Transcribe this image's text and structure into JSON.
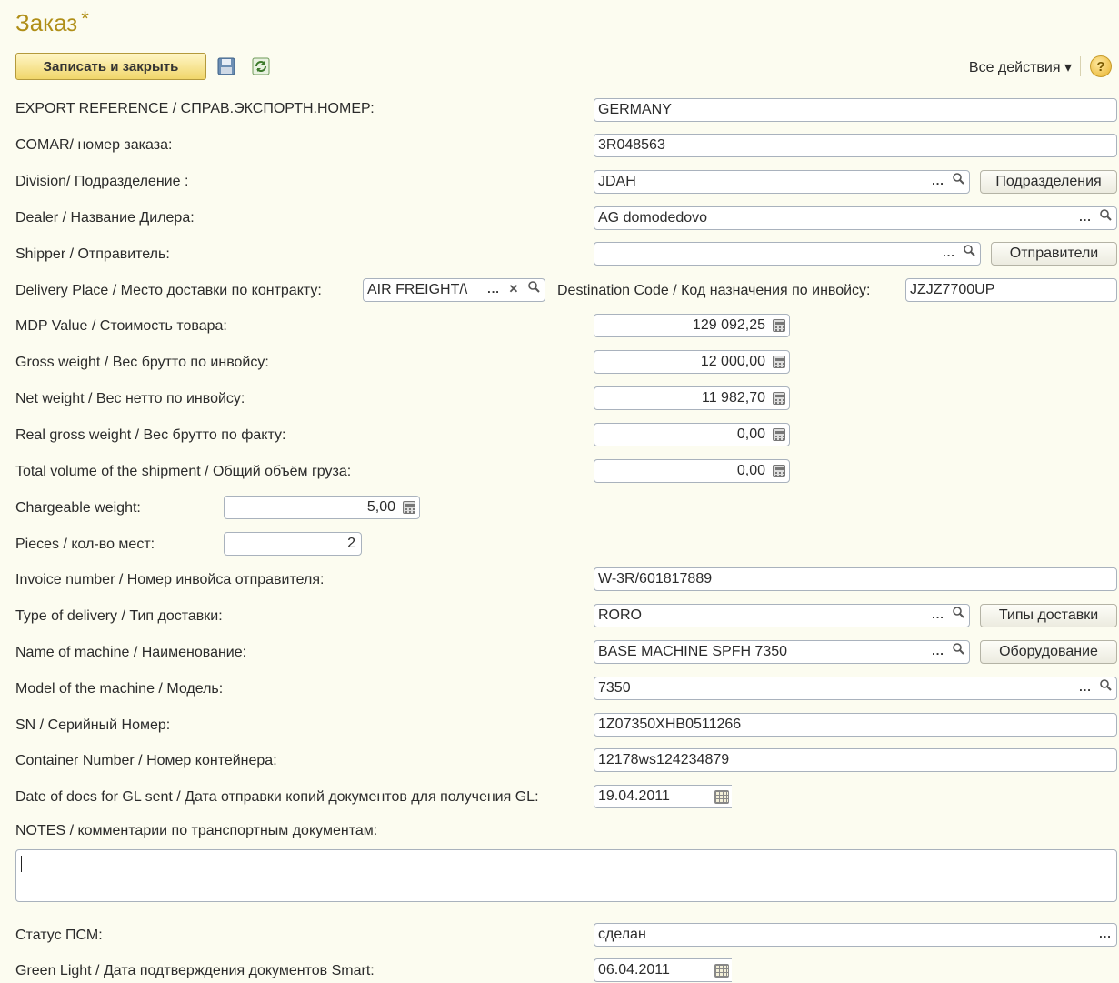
{
  "window": {
    "title": "Заказ",
    "modified_mark": "*"
  },
  "toolbar": {
    "save_close": "Записать и закрыть",
    "all_actions": "Все действия ▾",
    "help": "?",
    "save_icon": "floppy-disk-icon",
    "refresh_icon": "refresh-icon"
  },
  "fields": {
    "export_ref": {
      "label": "EXPORT REFERENCE / СПРАВ.ЭКСПОРТН.НОМЕР:",
      "value": "GERMANY"
    },
    "comar": {
      "label": "COMAR/ номер заказа:",
      "value": "3R048563"
    },
    "division": {
      "label": "Division/ Подразделение :",
      "value": "JDAH",
      "button": "Подразделения"
    },
    "dealer": {
      "label": "Dealer / Название Дилера:",
      "value": "AG domodedovo"
    },
    "shipper": {
      "label": "Shipper / Отправитель:",
      "value": "",
      "button": "Отправители"
    },
    "delivery_place": {
      "label": "Delivery Place / Место доставки по контракту:",
      "value": "AIR FREIGHT/\\"
    },
    "dest_code": {
      "label": "Destination Code / Код назначения по инвойсу:",
      "value": "JZJZ7700UP"
    },
    "mdp_value": {
      "label": "MDP Value / Стоимость товара:",
      "value": "129 092,25"
    },
    "gross_weight": {
      "label": "Gross weight / Вес брутто по инвойсу:",
      "value": "12 000,00"
    },
    "net_weight": {
      "label": "Net weight / Вес нетто по инвойсу:",
      "value": "11 982,70"
    },
    "real_gross": {
      "label": "Real gross weight / Вес брутто по факту:",
      "value": "0,00"
    },
    "total_volume": {
      "label": "Total volume of the shipment / Общий объём груза:",
      "value": "0,00"
    },
    "chargeable": {
      "label": "Chargeable weight:",
      "value": "5,00"
    },
    "pieces": {
      "label": "Pieces / кол-во мест:",
      "value": "2"
    },
    "invoice": {
      "label": "Invoice number / Номер инвойса отправителя:",
      "value": "W-3R/601817889"
    },
    "delivery_type": {
      "label": "Type of delivery / Тип доставки:",
      "value": "RORO",
      "button": "Типы доставки"
    },
    "machine_name": {
      "label": "Name of machine / Наименование:",
      "value": "BASE MACHINE SPFH 7350",
      "button": "Оборудование"
    },
    "model": {
      "label": "Model of the machine / Модель:",
      "value": "7350"
    },
    "serial": {
      "label": "SN / Серийный Номер:",
      "value": "1Z07350XHB0511266"
    },
    "container": {
      "label": "Container Number / Номер контейнера:",
      "value": "12178ws124234879"
    },
    "gl_sent_date": {
      "label": "Date of docs for GL sent / Дата отправки копий документов для получения GL:",
      "value": "19.04.2011"
    },
    "notes": {
      "label": "NOTES / комментарии по транспортным документам:",
      "value": ""
    },
    "psm_status": {
      "label": "Статус ПСМ:",
      "value": "сделан"
    },
    "green_light": {
      "label": "Green Light / Дата подтверждения документов Smart:",
      "value": "06.04.2011"
    }
  },
  "glyphs": {
    "ellipsis": "...",
    "clear": "✕",
    "search": "🔍"
  }
}
